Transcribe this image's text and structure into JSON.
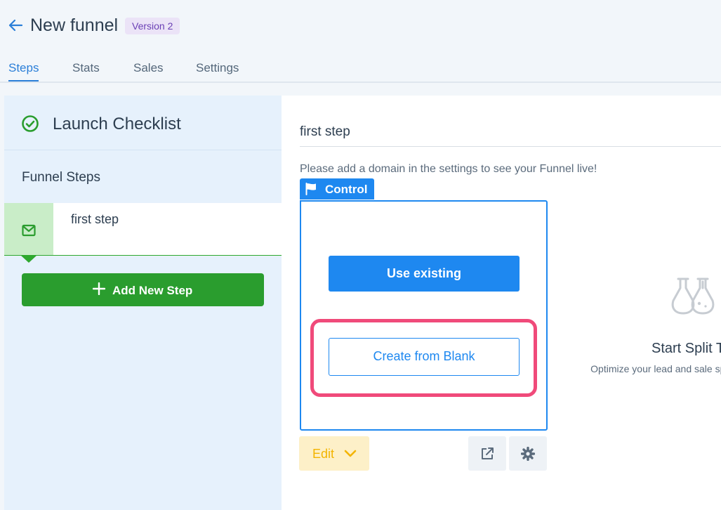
{
  "header": {
    "title": "New funnel",
    "version_badge": "Version 2"
  },
  "tabs": [
    {
      "label": "Steps",
      "active": true
    },
    {
      "label": "Stats",
      "active": false
    },
    {
      "label": "Sales",
      "active": false
    },
    {
      "label": "Settings",
      "active": false
    }
  ],
  "sidebar": {
    "checklist_label": "Launch Checklist",
    "steps_heading": "Funnel Steps",
    "steps": [
      {
        "name": "first step",
        "icon": "mail-icon"
      }
    ],
    "add_step_label": "Add New Step"
  },
  "main": {
    "step_title": "first step",
    "domain_note": "Please add a domain in the settings to see your Funnel live!",
    "control_label": "Control",
    "use_existing_label": "Use existing",
    "create_blank_label": "Create from Blank",
    "edit_label": "Edit",
    "split_title": "Start Split T",
    "split_description": "Optimize your lead and sale split tests."
  },
  "colors": {
    "accent": "#1e88f0",
    "success": "#2a9d2e",
    "highlight": "#f04a7a",
    "edit": "#f3b400",
    "version_badge": "#6a3fb5"
  }
}
